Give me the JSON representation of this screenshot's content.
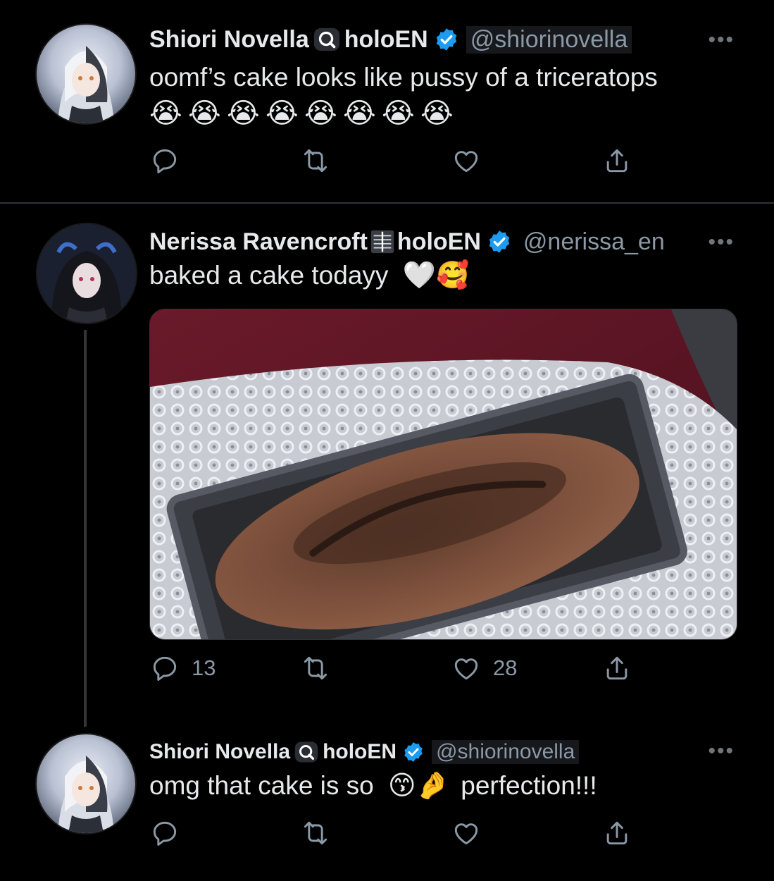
{
  "tweets": [
    {
      "name": "Shiori Novella",
      "affiliation": "holoEN",
      "handle": "@shiorinovella",
      "text": "oomf’s cake looks like pussy of a triceratops",
      "emoji_row": [
        "😭",
        "😭",
        "😭",
        "😭",
        "😭",
        "😭",
        "😭",
        "😭"
      ],
      "actions": {
        "reply_count": "",
        "retweet_count": "",
        "like_count": ""
      }
    },
    {
      "name": "Nerissa Ravencroft",
      "affiliation": "holoEN",
      "handle": "@nerissa_en",
      "text": "baked a cake todayy",
      "emojis": [
        "🤍",
        "🥰"
      ],
      "actions": {
        "reply_count": "13",
        "retweet_count": "",
        "like_count": "28"
      }
    },
    {
      "name": "Shiori Novella",
      "affiliation": "holoEN",
      "handle": "@shiorinovella",
      "text_before": "omg that cake is so",
      "emojis": [
        "😙",
        "🤌"
      ],
      "text_after": "perfection!!!",
      "actions": {
        "reply_count": "",
        "retweet_count": "",
        "like_count": ""
      }
    }
  ],
  "icons": {
    "more": "more-options-icon",
    "reply": "reply-icon",
    "retweet": "retweet-icon",
    "like": "like-icon",
    "share": "share-icon",
    "verified": "verified-badge-icon"
  },
  "colors": {
    "background": "#000000",
    "text": "#e7e9ea",
    "muted": "#8b98a5",
    "verified": "#1d9bf0"
  }
}
